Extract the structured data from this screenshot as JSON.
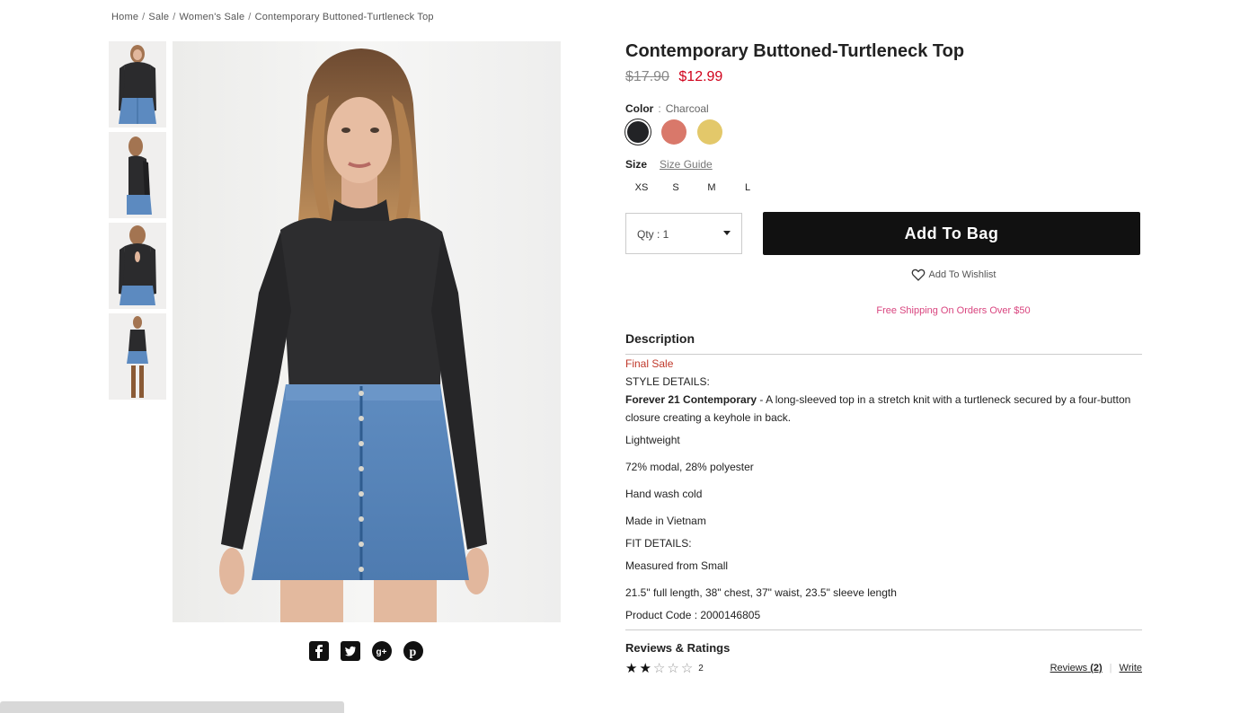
{
  "breadcrumb": [
    "Home",
    "Sale",
    "Women's Sale",
    "Contemporary Buttoned-Turtleneck Top"
  ],
  "product": {
    "title": "Contemporary Buttoned-Turtleneck Top",
    "old_price": "$17.90",
    "new_price": "$12.99",
    "color_label": "Color",
    "color_value": "Charcoal",
    "swatches": [
      {
        "name": "Charcoal",
        "hex": "#222326"
      },
      {
        "name": "Coral",
        "hex": "#d9786a"
      },
      {
        "name": "Yellow",
        "hex": "#e3c86a"
      }
    ],
    "size_label": "Size",
    "size_guide": "Size Guide",
    "sizes": [
      "XS",
      "S",
      "M",
      "L"
    ],
    "qty_label": "Qty : 1",
    "add_to_bag": "Add To Bag",
    "wishlist": "Add To Wishlist",
    "shipping_note": "Free Shipping On Orders Over $50"
  },
  "description": {
    "heading": "Description",
    "final_sale": "Final Sale",
    "style_details": "STYLE DETAILS:",
    "brand": "Forever 21 Contemporary",
    "summary": " - A long-sleeved top in a stretch knit with a turtleneck secured by a four-button closure creating a keyhole in back.",
    "features": [
      "Lightweight",
      "72% modal, 28% polyester",
      "Hand wash cold",
      "Made in Vietnam"
    ],
    "fit_details": "FIT DETAILS:",
    "measured": "Measured from Small",
    "measurements": "21.5\" full length, 38\" chest, 37\" waist, 23.5\" sleeve length",
    "product_code": "Product Code : 2000146805"
  },
  "reviews": {
    "heading": "Reviews & Ratings",
    "rating": 2,
    "max": 5,
    "count": "2",
    "reviews_link": "Reviews",
    "reviews_count": "(2)",
    "write_link": "Write"
  },
  "colors": {
    "sale_red": "#d0021b",
    "shipping_pink": "#d9457f",
    "button_black": "#111111"
  }
}
